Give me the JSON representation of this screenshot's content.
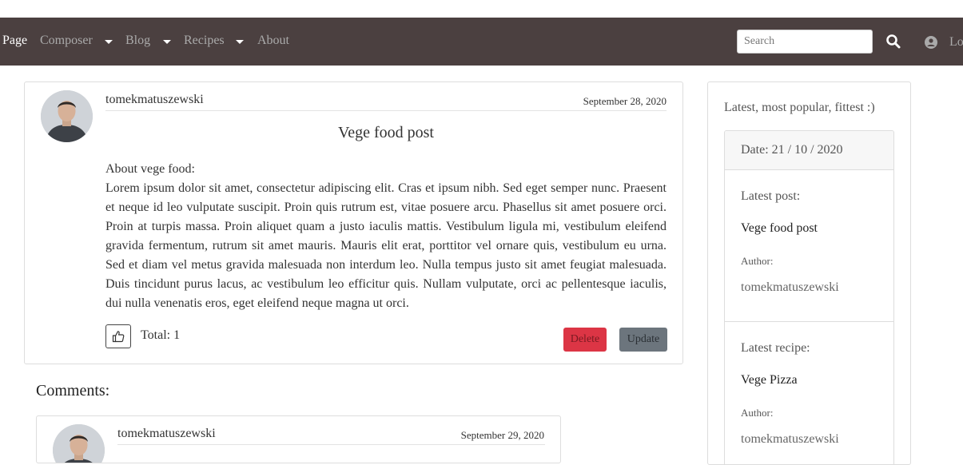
{
  "nav": {
    "brand": "Page",
    "items": [
      {
        "label": "Composer",
        "dropdown": true
      },
      {
        "label": "Blog",
        "dropdown": true
      },
      {
        "label": "Recipes",
        "dropdown": true
      },
      {
        "label": "About",
        "dropdown": false
      }
    ],
    "search_placeholder": "Search",
    "search_icon": "search-icon",
    "user_icon": "user-circle-icon",
    "login_label": "Lo"
  },
  "post": {
    "author": "tomekmatuszewski",
    "date": "September 28, 2020",
    "title": "Vege food post",
    "intro": "About vege food:",
    "body": "Lorem ipsum dolor sit amet, consectetur adipiscing elit. Cras et ipsum nibh. Sed eget semper nunc. Praesent et neque id leo vulputate suscipit. Proin quis rutrum est, vitae posuere arcu. Phasellus sit amet posuere orci. Proin at turpis massa. Proin aliquet quam a justo iaculis mattis. Vestibulum ligula mi, vestibulum eleifend gravida fermentum, rutrum sit amet mauris. Mauris elit erat, porttitor vel ornare quis, vestibulum eu urna. Sed et diam vel metus gravida malesuada non interdum leo. Nulla tempus justo sit amet feugiat malesuada. Duis tincidunt purus lacus, ac vestibulum leo efficitur quis. Nullam vulputate, orci ac pellentesque iaculis, dui nulla venenatis eros, eget eleifend neque magna ut orci.",
    "like_icon": "thumbs-up-icon",
    "total_label": "Total: 1",
    "delete_label": "Delete",
    "update_label": "Update"
  },
  "comments": {
    "title": "Comments:",
    "items": [
      {
        "author": "tomekmatuszewski",
        "date": "September 29, 2020"
      }
    ]
  },
  "sidebar": {
    "heading": "Latest, most popular, fittest :)",
    "date_label": "Date: 21 / 10 / 2020",
    "latest_post_label": "Latest post:",
    "latest_post_title": "Vege food post",
    "latest_post_author_label": "Author:",
    "latest_post_author": "tomekmatuszewski",
    "latest_recipe_label": "Latest recipe:",
    "latest_recipe_title": "Vege Pizza",
    "latest_recipe_author_label": "Author:",
    "latest_recipe_author": "tomekmatuszewski"
  },
  "colors": {
    "navbar_bg": "#4b4040",
    "delete_bg": "#dc3545",
    "update_bg": "#6c757d"
  }
}
